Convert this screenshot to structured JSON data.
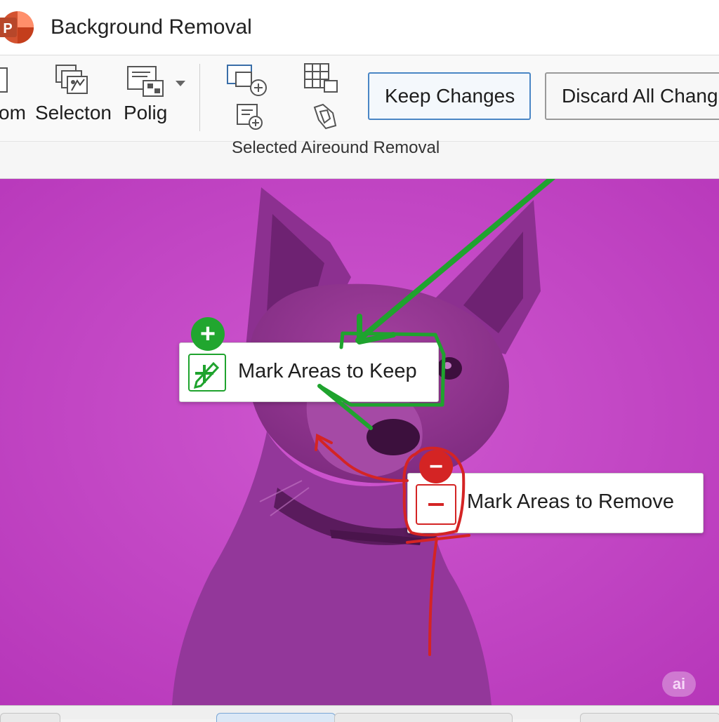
{
  "window": {
    "title": "Background Removal",
    "app_icon_letter": "P"
  },
  "ribbon": {
    "zoom_label": "om",
    "selection_label": "Selecton",
    "polygon_label": "Polig",
    "keep_changes_label": "Keep Changes",
    "discard_label": "Discard All Chang",
    "group_caption": "Selected Aireound Removal"
  },
  "callouts": {
    "keep_label": "Mark Areas to Keep",
    "remove_label": "Mark Areas to Remove",
    "plus_symbol": "+",
    "minus_symbol": "−"
  },
  "badge": "ai",
  "colors": {
    "accent_blue": "#4a86c5",
    "magenta_overlay": "#c444c6",
    "keep_green": "#1fa32e",
    "remove_red": "#d42424"
  }
}
